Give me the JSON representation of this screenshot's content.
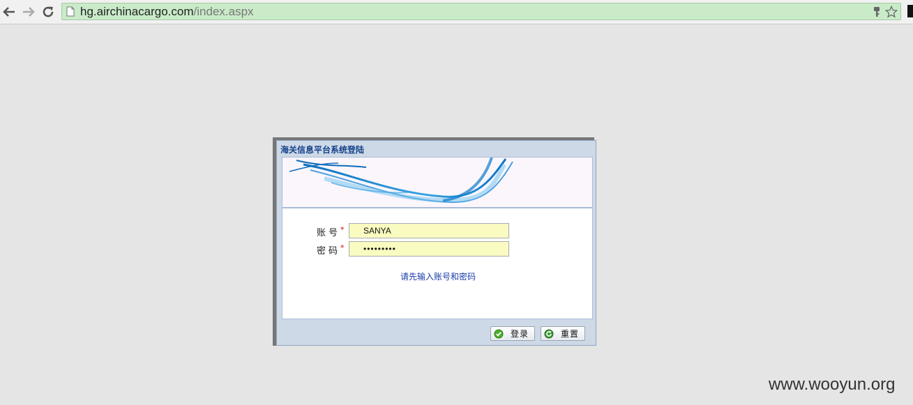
{
  "browser": {
    "url_host": "hg.airchinacargo.com",
    "url_path": "/index.aspx"
  },
  "dialog": {
    "title": "海关信息平台系统登陆",
    "account_label": "账号",
    "password_label": "密码",
    "required_mark": "*",
    "account_value": "SANYA",
    "password_value": "•••••••••",
    "hint": "请先输入账号和密码",
    "login_button": "登录",
    "reset_button": "重置"
  },
  "watermark": "www.wooyun.org",
  "colors": {
    "title": "#15428b",
    "field_bg": "#fafbc0",
    "hint": "#1a3ca8",
    "omnibox": "#c9ebc8"
  }
}
